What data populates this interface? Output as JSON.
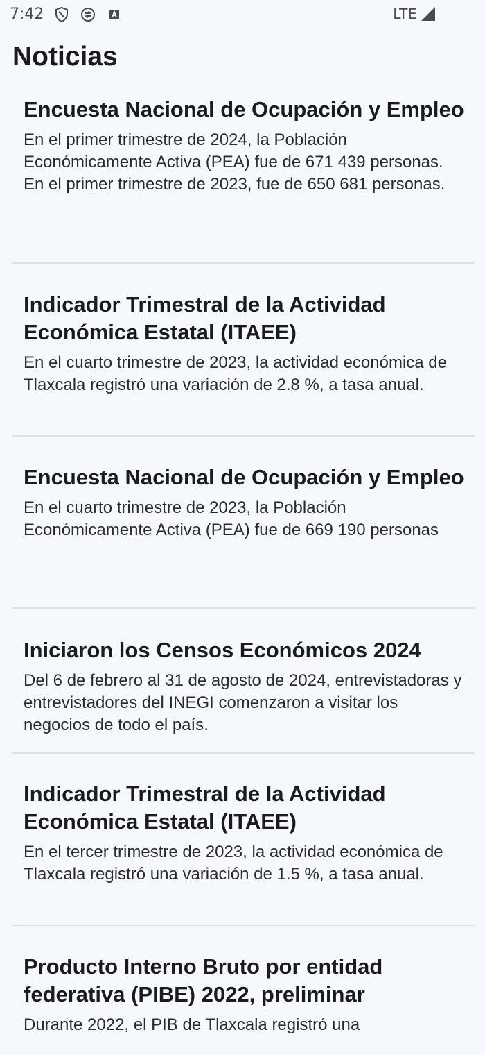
{
  "status_bar": {
    "time": "7:42",
    "network": "LTE",
    "icons": [
      "shield-icon",
      "sync-icon",
      "a-badge-icon",
      "signal-icon"
    ]
  },
  "page": {
    "title": "Noticias"
  },
  "news": [
    {
      "title": "Encuesta Nacional de Ocupación y Empleo",
      "body": "En el primer trimestre de 2024, la Población Económicamente Activa (PEA) fue de 671 439 personas. En el primer trimestre de 2023, fue de 650 681 personas."
    },
    {
      "title": "Indicador Trimestral de la Actividad Económica Estatal (ITAEE)",
      "body": "En el cuarto trimestre de 2023, la actividad económica de Tlaxcala registró una variación de 2.8 %, a tasa anual."
    },
    {
      "title": "Encuesta Nacional de Ocupación y Empleo",
      "body": "En el cuarto trimestre de 2023, la Población Económicamente Activa (PEA) fue de 669 190 personas"
    },
    {
      "title": "Iniciaron los Censos Económicos 2024",
      "body": "Del 6 de febrero al 31 de agosto de 2024, entrevistadoras y entrevistadores del INEGI comenzaron a visitar los negocios de todo el país."
    },
    {
      "title": "Indicador Trimestral de la Actividad Económica Estatal (ITAEE)",
      "body": "En el tercer trimestre de 2023, la actividad económica de Tlaxcala registró una variación de 1.5 %, a tasa anual."
    },
    {
      "title": "Producto Interno Bruto por entidad federativa (PIBE) 2022, preliminar",
      "body": "Durante 2022, el PIB de Tlaxcala registró una"
    }
  ]
}
